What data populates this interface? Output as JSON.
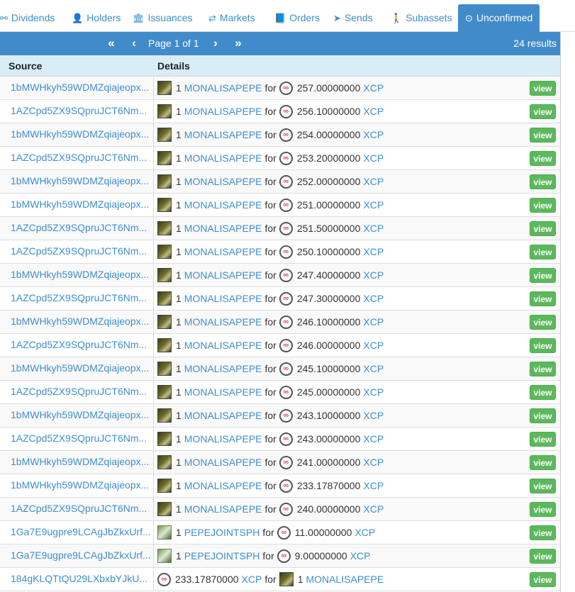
{
  "tabs": [
    {
      "label": "Dividends",
      "icon": "sitemap-icon",
      "glyph": "⚯"
    },
    {
      "label": "Holders",
      "icon": "user-icon",
      "glyph": "👤"
    },
    {
      "label": "Issuances",
      "icon": "bank-icon",
      "glyph": "🏛"
    },
    {
      "label": "Markets",
      "icon": "exchange-icon",
      "glyph": "⇄"
    },
    {
      "label": "Orders",
      "icon": "book-icon",
      "glyph": "📘"
    },
    {
      "label": "Sends",
      "icon": "paper-plane-icon",
      "glyph": "➤"
    },
    {
      "label": "Subassets",
      "icon": "child-icon",
      "glyph": "🚶"
    },
    {
      "label": "Unconfirmed",
      "icon": "clock-icon",
      "glyph": "⊙"
    }
  ],
  "pager": {
    "first": "«",
    "prev": "‹",
    "info": "Page 1 of 1",
    "next": "›",
    "last": "»",
    "results": "24 results"
  },
  "table": {
    "headers": {
      "source": "Source",
      "details": "Details"
    },
    "view_label": "view",
    "rows": [
      {
        "source": "1bMWHkyh59WDMZqiajeopx...",
        "qty": "1",
        "asset": "MONALISAPEPE",
        "word": "for",
        "amount": "257.00000000",
        "currency": "XCP"
      },
      {
        "source": "1AZCpd5ZX9SQpruJCT6Nm...",
        "qty": "1",
        "asset": "MONALISAPEPE",
        "word": "for",
        "amount": "256.10000000",
        "currency": "XCP"
      },
      {
        "source": "1bMWHkyh59WDMZqiajeopx...",
        "qty": "1",
        "asset": "MONALISAPEPE",
        "word": "for",
        "amount": "254.00000000",
        "currency": "XCP"
      },
      {
        "source": "1AZCpd5ZX9SQpruJCT6Nm...",
        "qty": "1",
        "asset": "MONALISAPEPE",
        "word": "for",
        "amount": "253.20000000",
        "currency": "XCP"
      },
      {
        "source": "1bMWHkyh59WDMZqiajeopx...",
        "qty": "1",
        "asset": "MONALISAPEPE",
        "word": "for",
        "amount": "252.00000000",
        "currency": "XCP"
      },
      {
        "source": "1bMWHkyh59WDMZqiajeopx...",
        "qty": "1",
        "asset": "MONALISAPEPE",
        "word": "for",
        "amount": "251.00000000",
        "currency": "XCP"
      },
      {
        "source": "1AZCpd5ZX9SQpruJCT6Nm...",
        "qty": "1",
        "asset": "MONALISAPEPE",
        "word": "for",
        "amount": "251.50000000",
        "currency": "XCP"
      },
      {
        "source": "1AZCpd5ZX9SQpruJCT6Nm...",
        "qty": "1",
        "asset": "MONALISAPEPE",
        "word": "for",
        "amount": "250.10000000",
        "currency": "XCP"
      },
      {
        "source": "1bMWHkyh59WDMZqiajeopx...",
        "qty": "1",
        "asset": "MONALISAPEPE",
        "word": "for",
        "amount": "247.40000000",
        "currency": "XCP"
      },
      {
        "source": "1AZCpd5ZX9SQpruJCT6Nm...",
        "qty": "1",
        "asset": "MONALISAPEPE",
        "word": "for",
        "amount": "247.30000000",
        "currency": "XCP"
      },
      {
        "source": "1bMWHkyh59WDMZqiajeopx...",
        "qty": "1",
        "asset": "MONALISAPEPE",
        "word": "for",
        "amount": "246.10000000",
        "currency": "XCP"
      },
      {
        "source": "1AZCpd5ZX9SQpruJCT6Nm...",
        "qty": "1",
        "asset": "MONALISAPEPE",
        "word": "for",
        "amount": "246.00000000",
        "currency": "XCP"
      },
      {
        "source": "1bMWHkyh59WDMZqiajeopx...",
        "qty": "1",
        "asset": "MONALISAPEPE",
        "word": "for",
        "amount": "245.10000000",
        "currency": "XCP"
      },
      {
        "source": "1AZCpd5ZX9SQpruJCT6Nm...",
        "qty": "1",
        "asset": "MONALISAPEPE",
        "word": "for",
        "amount": "245.00000000",
        "currency": "XCP"
      },
      {
        "source": "1bMWHkyh59WDMZqiajeopx...",
        "qty": "1",
        "asset": "MONALISAPEPE",
        "word": "for",
        "amount": "243.10000000",
        "currency": "XCP"
      },
      {
        "source": "1AZCpd5ZX9SQpruJCT6Nm...",
        "qty": "1",
        "asset": "MONALISAPEPE",
        "word": "for",
        "amount": "243.00000000",
        "currency": "XCP"
      },
      {
        "source": "1bMWHkyh59WDMZqiajeopx...",
        "qty": "1",
        "asset": "MONALISAPEPE",
        "word": "for",
        "amount": "241.00000000",
        "currency": "XCP"
      },
      {
        "source": "1bMWHkyh59WDMZqiajeopx...",
        "qty": "1",
        "asset": "MONALISAPEPE",
        "word": "for",
        "amount": "233.17870000",
        "currency": "XCP"
      },
      {
        "source": "1AZCpd5ZX9SQpruJCT6Nm...",
        "qty": "1",
        "asset": "MONALISAPEPE",
        "word": "for",
        "amount": "240.00000000",
        "currency": "XCP"
      },
      {
        "source": "1Ga7E9ugpre9LCAgJbZkxUrf...",
        "qty": "1",
        "asset": "PEPEJOINTSPH",
        "word": "for",
        "amount": "11.00000000",
        "currency": "XCP"
      },
      {
        "source": "1Ga7E9ugpre9LCAgJbZkxUrf...",
        "qty": "1",
        "asset": "PEPEJOINTSPH",
        "word": "for",
        "amount": "9.00000000",
        "currency": "XCP"
      },
      {
        "source": "184gKLQTtQU29LXbxbYJkU...",
        "qty": "1",
        "asset": "MONALISAPEPE",
        "word": "for",
        "amount": "233.17870000",
        "currency": "XCP",
        "reversed": true
      }
    ]
  }
}
